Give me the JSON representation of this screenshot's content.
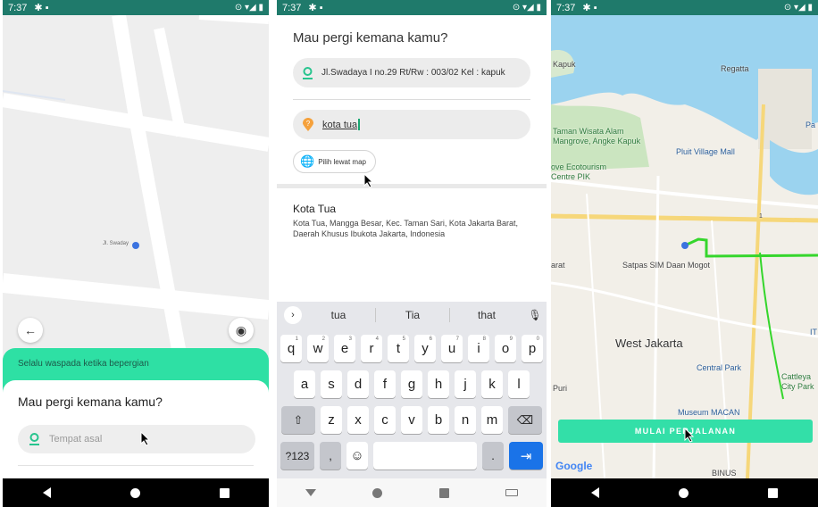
{
  "status_time": "7:37",
  "panel1": {
    "map_street_label": "Jl. Swaday",
    "warning_text": "Selalu waspada ketika bepergian",
    "sheet_title": "Mau pergi kemana kamu?",
    "origin_placeholder": "Tempat asal"
  },
  "panel2": {
    "title": "Mau pergi kemana kamu?",
    "origin_value": "Jl.Swadaya I no.29 Rt/Rw : 003/02 Kel : kapuk",
    "destination_value": "kota tua",
    "pick_map_label": "Pilih lewat map",
    "result_title": "Kota Tua",
    "result_address": "Kota Tua, Mangga Besar, Kec. Taman Sari, Kota Jakarta Barat, Daerah Khusus Ibukota Jakarta, Indonesia",
    "suggestions": [
      "tua",
      "Tia",
      "that"
    ],
    "keyboard": {
      "row1": [
        "q",
        "w",
        "e",
        "r",
        "t",
        "y",
        "u",
        "i",
        "o",
        "p"
      ],
      "row1_numbers": [
        "1",
        "2",
        "3",
        "4",
        "5",
        "6",
        "7",
        "8",
        "9",
        "0"
      ],
      "row2": [
        "a",
        "s",
        "d",
        "f",
        "g",
        "h",
        "j",
        "k",
        "l"
      ],
      "row3": [
        "z",
        "x",
        "c",
        "v",
        "b",
        "n",
        "m"
      ],
      "symbols_key": "?123",
      "comma_key": ",",
      "period_key": "."
    }
  },
  "panel3": {
    "labels": {
      "regatta": "Regatta",
      "kapuk": "Kapuk",
      "wisata": "Taman Wisata Alam Mangrove, Angke Kapuk",
      "pluit": "Pluit Village Mall",
      "ecotourism": "ove Ecotourism Centre PIK",
      "satpas": "Satpas SIM Daan Mogot",
      "west_jakarta": "West Jakarta",
      "central_park": "Central Park",
      "cattleya": "Cattleya City Park",
      "museum": "Museum MACAN",
      "binus": "BINUS",
      "puri": "Puri",
      "arat": "arat",
      "pa": "Pa",
      "it": "IT",
      "road_sign": "1"
    },
    "start_button": "MULAI PERJALANAN",
    "map_brand": "Google"
  },
  "colors": {
    "status_bar": "#1f7a6b",
    "accent_green": "#2ee0a4",
    "route": "#36d52e",
    "keyboard_enter": "#1a73e8"
  }
}
